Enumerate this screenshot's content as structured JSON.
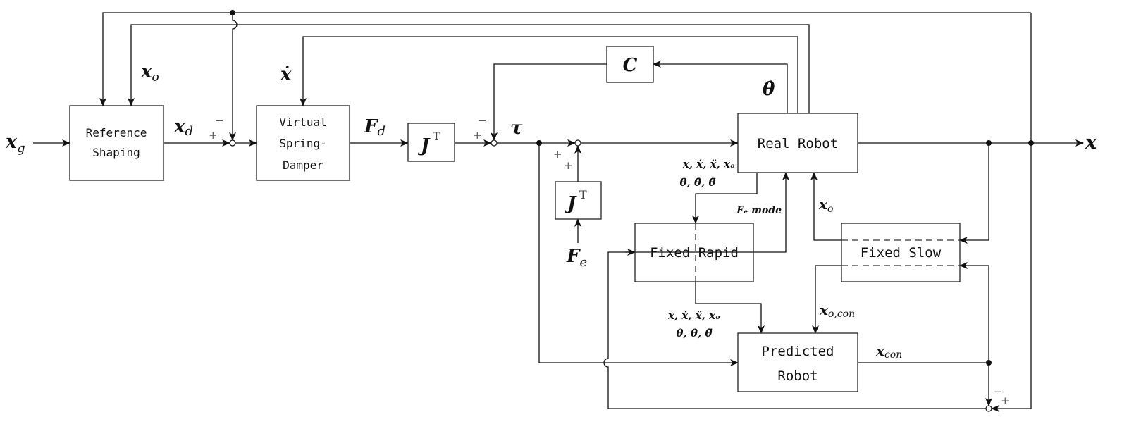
{
  "blocks": {
    "reference_shaping": [
      "Reference",
      "Shaping"
    ],
    "virtual_spring_damper": [
      "Virtual",
      "Spring-",
      "Damper"
    ],
    "jt_main": "J",
    "jt_force": "J",
    "transpose": "T",
    "c_block": "C",
    "real_robot": "Real Robot",
    "fixed_rapid": "Fixed Rapid",
    "fixed_slow": "Fixed Slow",
    "predicted_robot": [
      "Predicted",
      "Robot"
    ]
  },
  "signals": {
    "x_g": "x",
    "x_g_sub": "g",
    "x_o": "x",
    "x_o_sub": "o",
    "x_dot": "ẋ",
    "x_d": "x",
    "x_d_sub": "d",
    "F_d": "F",
    "F_d_sub": "d",
    "tau": "τ",
    "theta_dot": "θ̇",
    "F_e": "F",
    "F_e_sub": "e",
    "x_out": "x",
    "state_line1": "x, ẋ, ẍ, xₒ",
    "state_line2": "θ, θ̇, θ̈",
    "fe_mode": "Fₑ mode",
    "x_o_right": "x",
    "x_o_right_sub": "o",
    "x_o_con": "x",
    "x_o_con_sub": "o,con",
    "x_con": "x",
    "x_con_sub": "con"
  },
  "signs": {
    "minus": "−",
    "plus": "+"
  }
}
